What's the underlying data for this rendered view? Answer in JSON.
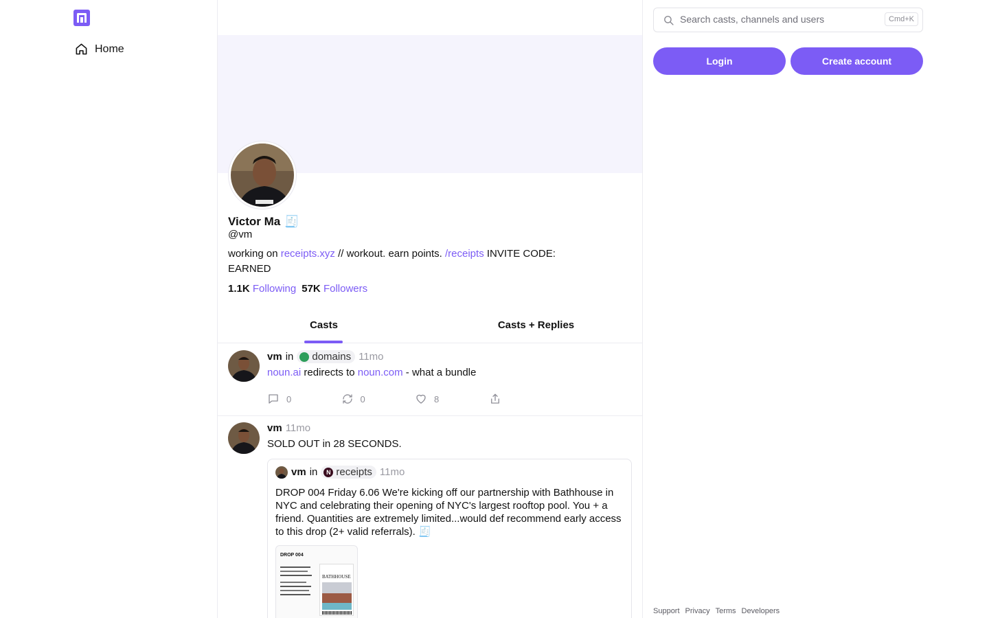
{
  "nav": {
    "home_label": "Home"
  },
  "profile": {
    "display_name": "Victor Ma",
    "name_emoji": "🧾",
    "handle": "@vm",
    "bio": {
      "prefix": "working on ",
      "link1": "receipts.xyz",
      "middle": " // workout. earn points. ",
      "link2": "/receipts",
      "suffix": " INVITE CODE: EARNED"
    },
    "following_count": "1.1K",
    "following_label": "Following",
    "followers_count": "57K",
    "followers_label": "Followers"
  },
  "tabs": [
    {
      "label": "Casts",
      "active": true
    },
    {
      "label": "Casts + Replies",
      "active": false
    }
  ],
  "casts": [
    {
      "author": "vm",
      "in_label": "in",
      "channel": "domains",
      "time": "11mo",
      "text_link1": "noun.ai",
      "text_mid": " redirects to ",
      "text_link2": "noun.com",
      "text_suffix": " - what a bundle",
      "replies": "0",
      "recasts": "0",
      "likes": "8"
    },
    {
      "author": "vm",
      "time": "11mo",
      "text": "SOLD OUT in 28 SECONDS.",
      "quote": {
        "author": "vm",
        "in_label": "in",
        "channel": "receipts",
        "time": "11mo",
        "text": "DROP 004 Friday 6.06 We're kicking off our partnership with Bathhouse in NYC and celebrating their opening of NYC's largest rooftop pool. You + a friend. Quantities are extremely limited...would def recommend early access to this drop (2+ valid referrals). 🧾",
        "image_title": "DROP 004",
        "image_brand": "BATHHOUSE"
      }
    }
  ],
  "search": {
    "placeholder": "Search casts, channels and users",
    "shortcut": "Cmd+K"
  },
  "auth": {
    "login_label": "Login",
    "create_label": "Create account"
  },
  "footer": [
    "Support",
    "Privacy",
    "Terms",
    "Developers"
  ],
  "colors": {
    "accent": "#7c5cf5",
    "banner": "#f5f4fd",
    "muted": "#9a9aa2"
  }
}
